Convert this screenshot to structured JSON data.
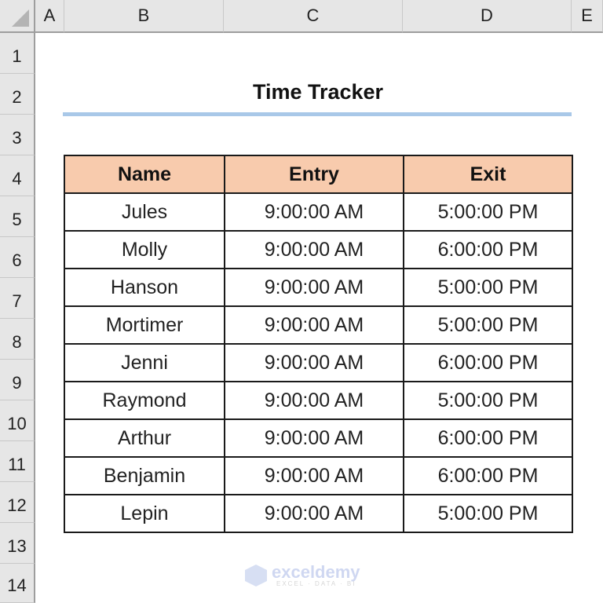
{
  "columns": [
    "A",
    "B",
    "C",
    "D",
    "E"
  ],
  "rows": [
    "1",
    "2",
    "3",
    "4",
    "5",
    "6",
    "7",
    "8",
    "9",
    "10",
    "11",
    "12",
    "13",
    "14"
  ],
  "sheet": {
    "title": "Time Tracker",
    "headers": [
      "Name",
      "Entry",
      "Exit"
    ],
    "records": [
      {
        "name": "Jules",
        "entry": "9:00:00 AM",
        "exit": "5:00:00 PM"
      },
      {
        "name": "Molly",
        "entry": "9:00:00 AM",
        "exit": "6:00:00 PM"
      },
      {
        "name": "Hanson",
        "entry": "9:00:00 AM",
        "exit": "5:00:00 PM"
      },
      {
        "name": "Mortimer",
        "entry": "9:00:00 AM",
        "exit": "5:00:00 PM"
      },
      {
        "name": "Jenni",
        "entry": "9:00:00 AM",
        "exit": "6:00:00 PM"
      },
      {
        "name": "Raymond",
        "entry": "9:00:00 AM",
        "exit": "5:00:00 PM"
      },
      {
        "name": "Arthur",
        "entry": "9:00:00 AM",
        "exit": "6:00:00 PM"
      },
      {
        "name": "Benjamin",
        "entry": "9:00:00 AM",
        "exit": "6:00:00 PM"
      },
      {
        "name": "Lepin",
        "entry": "9:00:00 AM",
        "exit": "5:00:00 PM"
      }
    ]
  },
  "watermark": {
    "brand": "exceldemy",
    "tagline": "EXCEL · DATA · BI"
  },
  "colors": {
    "header_fill": "#f8cbad",
    "title_underline": "#a9c8e8"
  }
}
